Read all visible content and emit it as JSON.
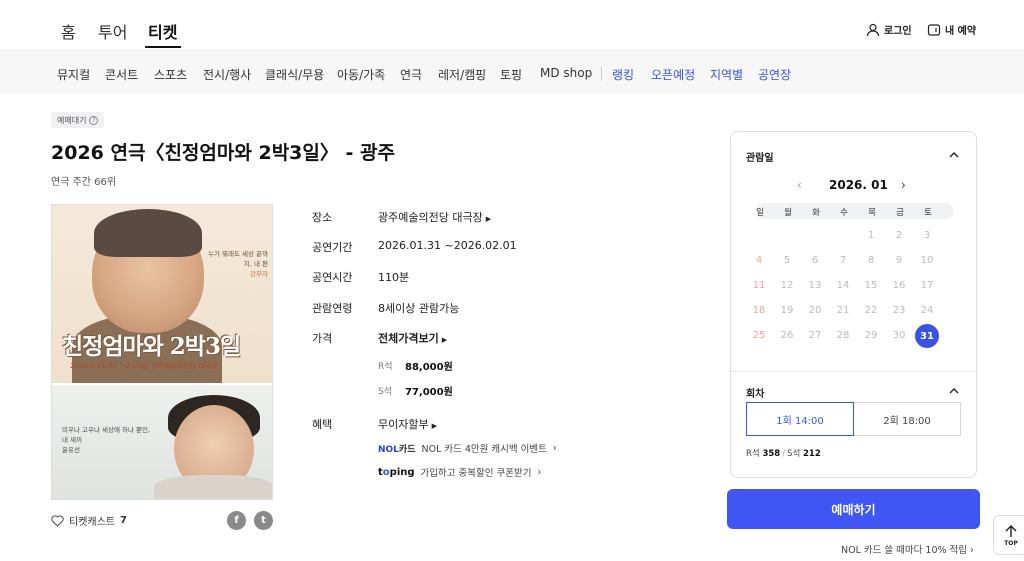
{
  "topnav": {
    "tabs": [
      "홈",
      "투어",
      "티켓"
    ],
    "active_tab": "티켓",
    "login_label": "로그인",
    "reservation_label": "내 예약"
  },
  "categories": {
    "items": [
      "뮤지컬",
      "콘서트",
      "스포츠",
      "전시/행사",
      "클래식/무용",
      "아동/가족",
      "연극",
      "레저/캠핑",
      "토핑",
      "MD shop"
    ],
    "highlight_items": [
      "랭킹",
      "오픈예정",
      "지역별",
      "공연장"
    ],
    "highlight_color": "#3b53e4"
  },
  "product": {
    "badge": "예매대기",
    "title": "2026 연극〈친정엄마와 2박3일〉 - 광주",
    "rank": "연극 주간 66위"
  },
  "poster": {
    "title": "친정엄마와 2박3일",
    "date_line": "2026.1.31(토) ~2.1(일) 광주예술의전당 대극장",
    "quote_top": "누가 뭐래도 세상 끝까지, 내 편",
    "quote_top_name": "강부자",
    "quote_bottom": "미우나 고우나 세상에 하나 뿐인, 내 새끼",
    "quote_bottom_name": "윤유선"
  },
  "social": {
    "like_label": "티켓캐스트",
    "like_count": "7",
    "facebook_icon": "f",
    "twitter_icon": "t"
  },
  "info": {
    "venue_label": "장소",
    "venue_value": "광주예술의전당 대극장",
    "period_label": "공연기간",
    "period_value": "2026.01.31 ~2026.02.01",
    "runtime_label": "공연시간",
    "runtime_value": "110분",
    "age_label": "관람연령",
    "age_value": "8세이상 관람가능",
    "price_label": "가격",
    "price_all": "전체가격보기",
    "prices": [
      {
        "grade": "R석",
        "price": "88,000원"
      },
      {
        "grade": "S석",
        "price": "77,000원"
      }
    ],
    "benefit_label": "혜택",
    "benefit_interest": "무이자할부",
    "nol_logo": "NOL",
    "nol_card": "카드",
    "nol_text": "NOL 카드 4만원 캐시백 이벤트",
    "toping_logo_t": "t",
    "toping_logo_o": "o",
    "toping_logo_rest": "ping",
    "toping_text": "가입하고 중복할인 쿠폰받기"
  },
  "booking": {
    "date_section": "관람일",
    "month": "2026. 01",
    "weekdays": [
      "일",
      "월",
      "화",
      "수",
      "목",
      "금",
      "토"
    ],
    "weeks": [
      [
        "",
        "",
        "",
        "",
        "1",
        "2",
        "3"
      ],
      [
        "4",
        "5",
        "6",
        "7",
        "8",
        "9",
        "10"
      ],
      [
        "11",
        "12",
        "13",
        "14",
        "15",
        "16",
        "17"
      ],
      [
        "18",
        "19",
        "20",
        "21",
        "22",
        "23",
        "24"
      ],
      [
        "25",
        "26",
        "27",
        "28",
        "29",
        "30",
        "31"
      ]
    ],
    "selected_day": "31",
    "session_section": "회차",
    "sessions": [
      "1회 14:00",
      "2회 18:00"
    ],
    "seat_r_label": "R석",
    "seat_r_count": "358",
    "seat_s_label": "S석",
    "seat_s_count": "212",
    "book_button": "예매하기",
    "promo": "NOL 카드 쓸 때마다 10% 적립 ›",
    "top_button": "TOP",
    "accent_color": "#3f55f4"
  }
}
